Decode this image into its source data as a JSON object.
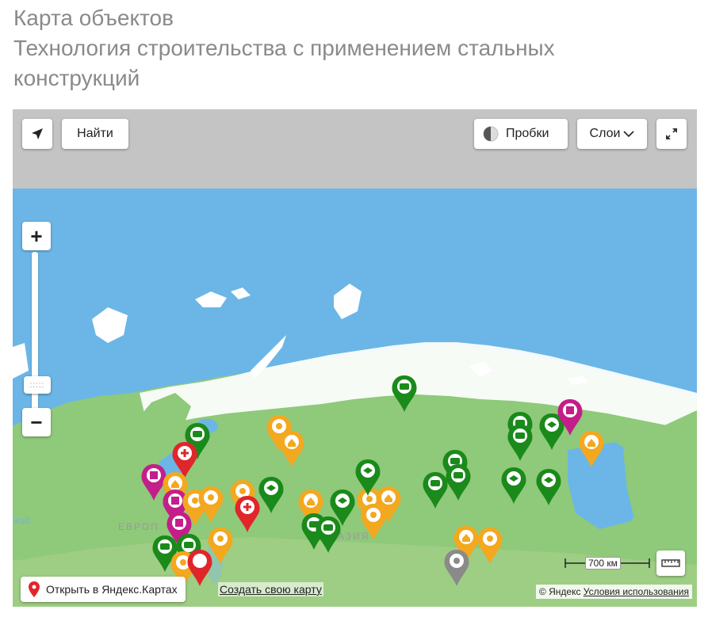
{
  "page": {
    "title_line1": "Карта объектов",
    "title_line2": "Технология строительства с применением стальных",
    "title_line3": "конструкций"
  },
  "map": {
    "find_button": "Найти",
    "traffic_button": "Пробки",
    "layers_button": "Слои",
    "zoom_in": "+",
    "zoom_out": "−",
    "open_in_yandex": "Открыть в Яндекс.Картах",
    "create_map": "Создать свою карту",
    "copyright": "© Яндекс",
    "terms": "Условия использования",
    "scale_label": "700 км",
    "region_label_europe": "ЕВРОП",
    "region_label_asia": "АЗИЯ",
    "partial_label_left": "жий",
    "colors": {
      "water": "#6bb6e6",
      "land": "#8fc97a",
      "ice": "#ffffff",
      "pin_green": "#1a8a1a",
      "pin_orange": "#f3a81f",
      "pin_red": "#e0262b",
      "pin_magenta": "#c41e8a",
      "pin_gray": "#8a8a8a"
    },
    "icons": {
      "locate": "arrow-locate-icon",
      "traffic": "traffic-light-icon",
      "layers_chevron": "chevron-down-icon",
      "fullscreen": "fullscreen-icon",
      "ruler": "ruler-icon",
      "yandex_pin": "map-pin-icon"
    }
  }
}
